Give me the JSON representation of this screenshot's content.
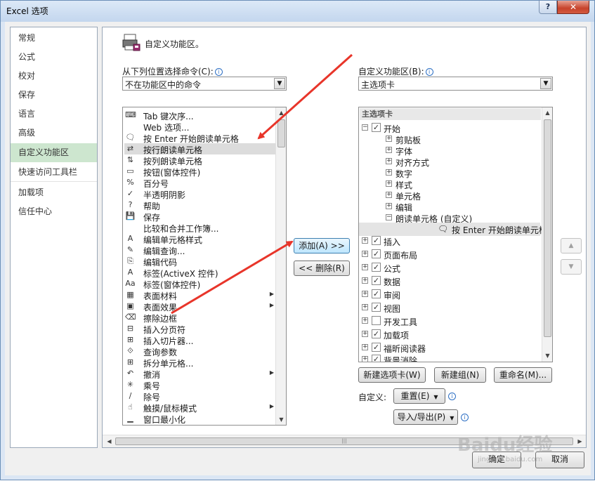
{
  "window": {
    "title": "Excel 选项",
    "help": "?",
    "close": "✕"
  },
  "nav": [
    "常规",
    "公式",
    "校对",
    "保存",
    "语言",
    "高级",
    "自定义功能区",
    "快速访问工具栏",
    "加载项",
    "信任中心"
  ],
  "panel": {
    "title": "自定义功能区。",
    "left_label": "从下列位置选择命令(C):",
    "left_combo": "不在功能区中的命令",
    "right_label": "自定义功能区(B):",
    "right_combo": "主选项卡"
  },
  "commands": [
    {
      "icon": "⌨",
      "label": "Tab 键次序..."
    },
    {
      "icon": "",
      "label": "Web 选项..."
    },
    {
      "icon": "🗨",
      "label": "按 Enter 开始朗读单元格"
    },
    {
      "icon": "⇄",
      "label": "按行朗读单元格"
    },
    {
      "icon": "⇅",
      "label": "按列朗读单元格"
    },
    {
      "icon": "▭",
      "label": "按钮(窗体控件)"
    },
    {
      "icon": "%",
      "label": "百分号"
    },
    {
      "icon": "✓",
      "label": "半透明阴影"
    },
    {
      "icon": "?",
      "label": "帮助"
    },
    {
      "icon": "💾",
      "label": "保存"
    },
    {
      "icon": "",
      "label": "比较和合并工作簿..."
    },
    {
      "icon": "A",
      "label": "编辑单元格样式"
    },
    {
      "icon": "✎",
      "label": "编辑查询..."
    },
    {
      "icon": "⎘",
      "label": "编辑代码"
    },
    {
      "icon": "A",
      "label": "标签(ActiveX 控件)"
    },
    {
      "icon": "Aa",
      "label": "标签(窗体控件)"
    },
    {
      "icon": "▦",
      "label": "表面材料",
      "sub": "▶"
    },
    {
      "icon": "▣",
      "label": "表面效果",
      "sub": "▶"
    },
    {
      "icon": "⌫",
      "label": "擦除边框"
    },
    {
      "icon": "⊟",
      "label": "插入分页符"
    },
    {
      "icon": "⊞",
      "label": "插入切片器..."
    },
    {
      "icon": "⟐",
      "label": "查询参数"
    },
    {
      "icon": "⊞",
      "label": "拆分单元格..."
    },
    {
      "icon": "↶",
      "label": "撤消",
      "sub": "▶"
    },
    {
      "icon": "✳",
      "label": "乘号"
    },
    {
      "icon": "∕",
      "label": "除号"
    },
    {
      "icon": "☝",
      "label": "触摸/鼠标模式",
      "sub": "▶"
    },
    {
      "icon": "▁",
      "label": "窗口最小化"
    }
  ],
  "tree": {
    "header": "主选项卡",
    "rows": [
      {
        "level": 0,
        "exp": "⊟",
        "checked": true,
        "label": "开始"
      },
      {
        "level": 1,
        "exp": "⊞",
        "label": "剪贴板"
      },
      {
        "level": 1,
        "exp": "⊞",
        "label": "字体"
      },
      {
        "level": 1,
        "exp": "⊞",
        "label": "对齐方式"
      },
      {
        "level": 1,
        "exp": "⊞",
        "label": "数字"
      },
      {
        "level": 1,
        "exp": "⊞",
        "label": "样式"
      },
      {
        "level": 1,
        "exp": "⊞",
        "label": "单元格"
      },
      {
        "level": 1,
        "exp": "⊞",
        "label": "编辑"
      },
      {
        "level": 1,
        "exp": "⊟",
        "label": "朗读单元格 (自定义)"
      },
      {
        "level": 2,
        "icon": "🗨",
        "label": "按 Enter 开始朗读单元格"
      },
      {
        "level": 0,
        "exp": "⊞",
        "checked": true,
        "label": "插入"
      },
      {
        "level": 0,
        "exp": "⊞",
        "checked": true,
        "label": "页面布局"
      },
      {
        "level": 0,
        "exp": "⊞",
        "checked": true,
        "label": "公式"
      },
      {
        "level": 0,
        "exp": "⊞",
        "checked": true,
        "label": "数据"
      },
      {
        "level": 0,
        "exp": "⊞",
        "checked": true,
        "label": "审阅"
      },
      {
        "level": 0,
        "exp": "⊞",
        "checked": true,
        "label": "视图"
      },
      {
        "level": 0,
        "exp": "⊞",
        "checked": false,
        "label": "开发工具"
      },
      {
        "level": 0,
        "exp": "⊞",
        "checked": true,
        "label": "加载项"
      },
      {
        "level": 0,
        "exp": "⊞",
        "checked": true,
        "label": "福昕阅读器"
      },
      {
        "level": 0,
        "exp": "⊞",
        "checked": true,
        "label": "背景消除"
      }
    ]
  },
  "buttons": {
    "add": "添加(A) >>",
    "remove": "<< 删除(R)",
    "new_tab": "新建选项卡(W)",
    "new_group": "新建组(N)",
    "rename": "重命名(M)...",
    "custom_label": "自定义:",
    "reset": "重置(E)",
    "import_export": "导入/导出(P)",
    "ok": "确定",
    "cancel": "取消",
    "up": "▲",
    "down": "▼"
  },
  "watermark": {
    "brand": "Baidu经验",
    "url": "jingyan.baidu.com"
  },
  "annotation_color": "#e8352a"
}
